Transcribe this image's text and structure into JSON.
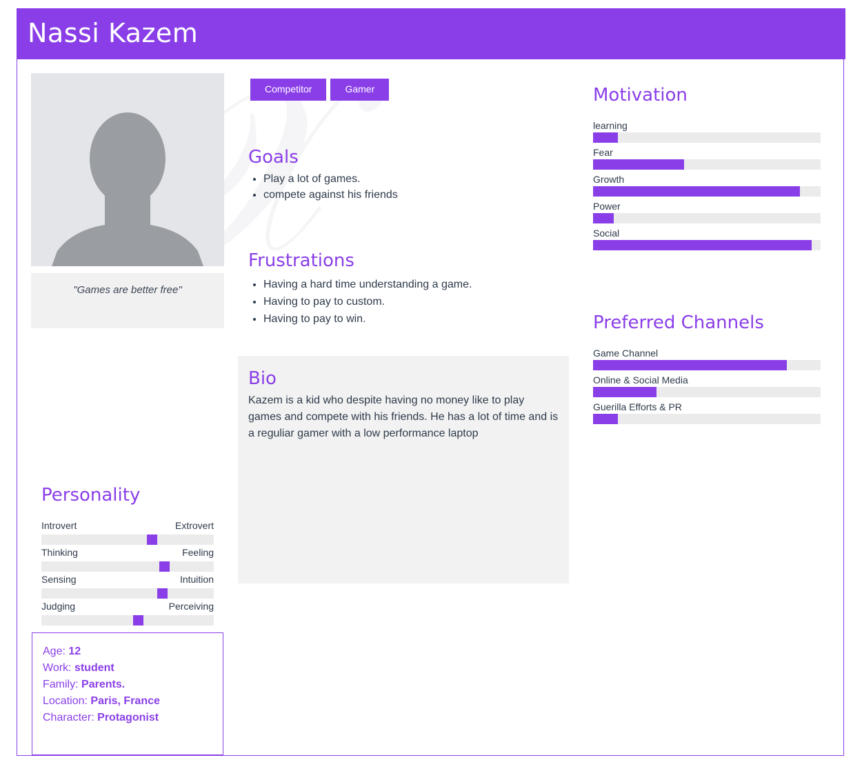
{
  "header": {
    "name": "Nassi Kazem"
  },
  "quote": "\"Games are better free\"",
  "tags": [
    "Competitor",
    "Gamer"
  ],
  "goals": {
    "title": "Goals",
    "items": [
      "Play a lot of games.",
      "compete against his friends"
    ]
  },
  "frustrations": {
    "title": "Frustrations",
    "items": [
      "Having a hard time understanding a game.",
      "Having to pay to custom.",
      "Having to pay to win."
    ]
  },
  "bio": {
    "title": "Bio",
    "text": "Kazem is a kid who despite having no money like to play games and compete with his friends. He has a lot of time and is a reguliar gamer with a low performance laptop"
  },
  "motivation": {
    "title": "Motivation",
    "items": [
      {
        "label": "learning",
        "value": 0.11
      },
      {
        "label": "Fear",
        "value": 0.4
      },
      {
        "label": "Growth",
        "value": 0.91
      },
      {
        "label": "Power",
        "value": 0.09
      },
      {
        "label": "Social",
        "value": 0.96
      }
    ]
  },
  "channels": {
    "title": "Preferred Channels",
    "items": [
      {
        "label": "Game Channel",
        "value": 0.85
      },
      {
        "label": "Online & Social Media",
        "value": 0.28
      },
      {
        "label": "Guerilla Efforts & PR",
        "value": 0.11
      }
    ]
  },
  "personality": {
    "title": "Personality",
    "items": [
      {
        "left": "Introvert",
        "right": "Extrovert",
        "value": 0.64
      },
      {
        "left": "Thinking",
        "right": "Feeling",
        "value": 0.71
      },
      {
        "left": "Sensing",
        "right": "Intuition",
        "value": 0.7
      },
      {
        "left": "Judging",
        "right": "Perceiving",
        "value": 0.56
      }
    ]
  },
  "info": {
    "age_label": "Age:",
    "age": "12",
    "work_label": "Work:",
    "work": "student",
    "family_label": "Family:",
    "family": "Parents.",
    "location_label": "Location:",
    "location": "Paris, France",
    "character_label": "Character:",
    "character": "Protagonist"
  },
  "colors": {
    "accent": "#8a3ee8",
    "panel": "#f2f2f2",
    "track": "#ebebec"
  }
}
